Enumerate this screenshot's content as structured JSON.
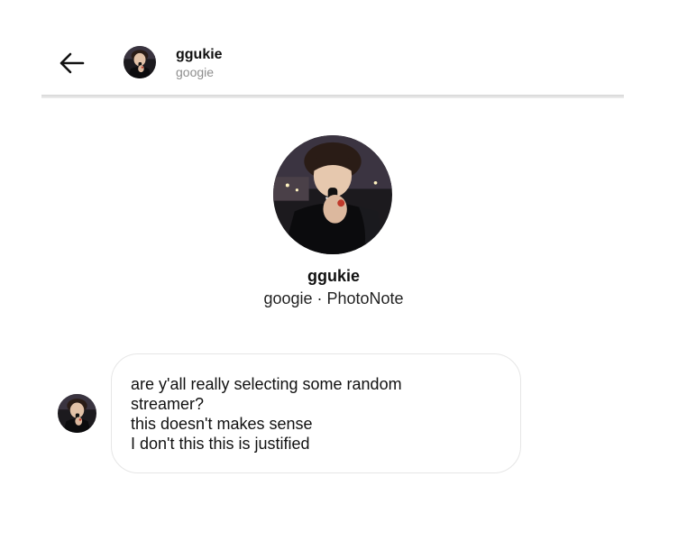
{
  "header": {
    "back_icon": "arrow-left-icon",
    "username": "ggukie",
    "display_name": "googie"
  },
  "profile": {
    "username": "ggukie",
    "subtitle": "googie · PhotoNote"
  },
  "message": {
    "lines": [
      "are y'all really selecting some random",
      "streamer?",
      "this doesn't makes sense",
      "I don't this this is justified"
    ]
  },
  "colors": {
    "secondary_text": "#8e8e8e",
    "bubble_border": "#e6e6e6",
    "divider": "#d6d6d6"
  }
}
